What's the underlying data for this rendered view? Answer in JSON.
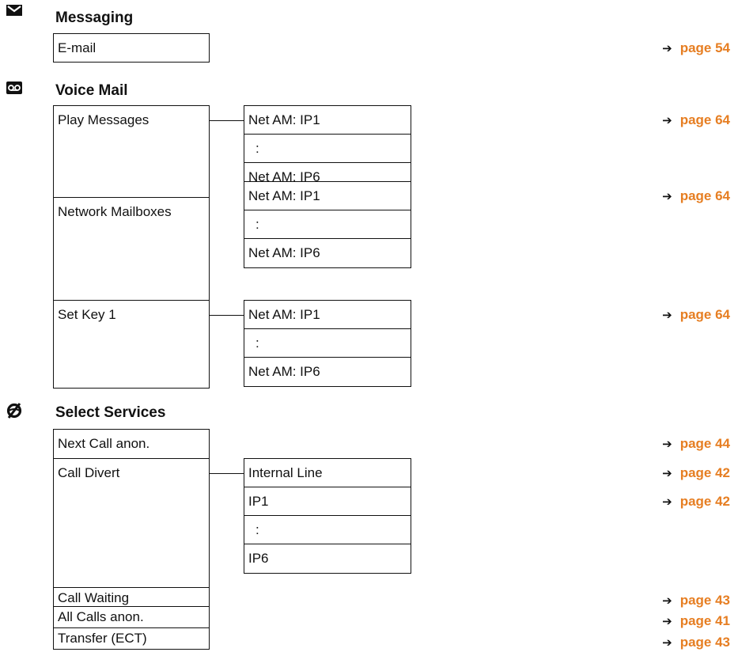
{
  "accent_color": "#e67e22",
  "sections": [
    {
      "icon": "envelope-icon",
      "title": "Messaging",
      "items": [
        {
          "label": "E-mail",
          "page": "page 54"
        }
      ]
    },
    {
      "icon": "voicemail-icon",
      "title": "Voice Mail",
      "items": [
        {
          "label": "Play Messages",
          "sub": [
            "Net AM: IP1",
            ":",
            "Net AM: IP6"
          ],
          "page": "page 64"
        },
        {
          "label": "Network Mailboxes",
          "sub": [
            "Net AM: IP1",
            ":",
            "Net AM: IP6"
          ],
          "page": "page 64"
        },
        {
          "label": "Set Key 1",
          "sub": [
            "Net AM: IP1",
            ":",
            "Net AM: IP6"
          ],
          "page": "page 64"
        }
      ]
    },
    {
      "icon": "services-icon",
      "title": "Select Services",
      "items": [
        {
          "label": "Next Call anon.",
          "page": "page 44"
        },
        {
          "label": "Call Divert",
          "sub": [
            "Internal Line",
            "IP1",
            ":",
            "IP6"
          ],
          "page": "page 42",
          "page2": "page 42"
        },
        {
          "label": "Call Waiting",
          "page": "page 43"
        },
        {
          "label": "All Calls anon.",
          "page": "page 41"
        },
        {
          "label": "Transfer (ECT)",
          "page": "page 43"
        }
      ]
    }
  ]
}
